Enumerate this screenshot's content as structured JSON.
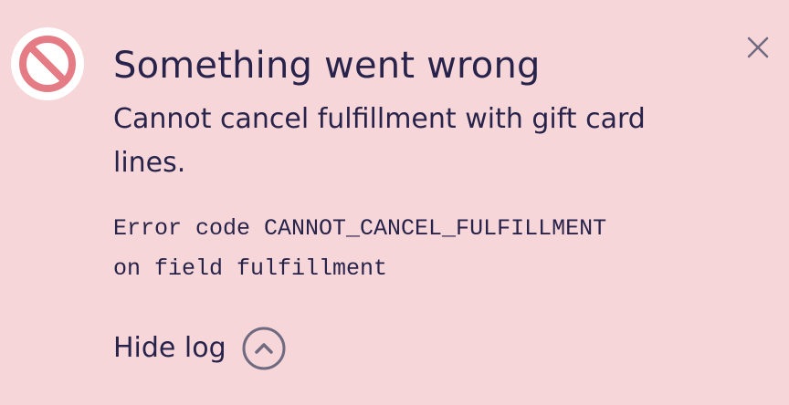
{
  "notification": {
    "icon": "error-prohibited-icon",
    "title": "Something went wrong",
    "message": "Cannot cancel fulfillment with gift card lines.",
    "log": {
      "line1": "Error code CANNOT_CANCEL_FULFILLMENT",
      "line2": "on field fulfillment"
    },
    "toggle_label": "Hide log",
    "toggle_icon": "chevron-up-icon",
    "close_icon": "close-icon"
  },
  "colors": {
    "background": "#f6d6d9",
    "icon_ring": "#e57c85",
    "text": "#28234a",
    "muted_icon": "#6f6a80"
  }
}
